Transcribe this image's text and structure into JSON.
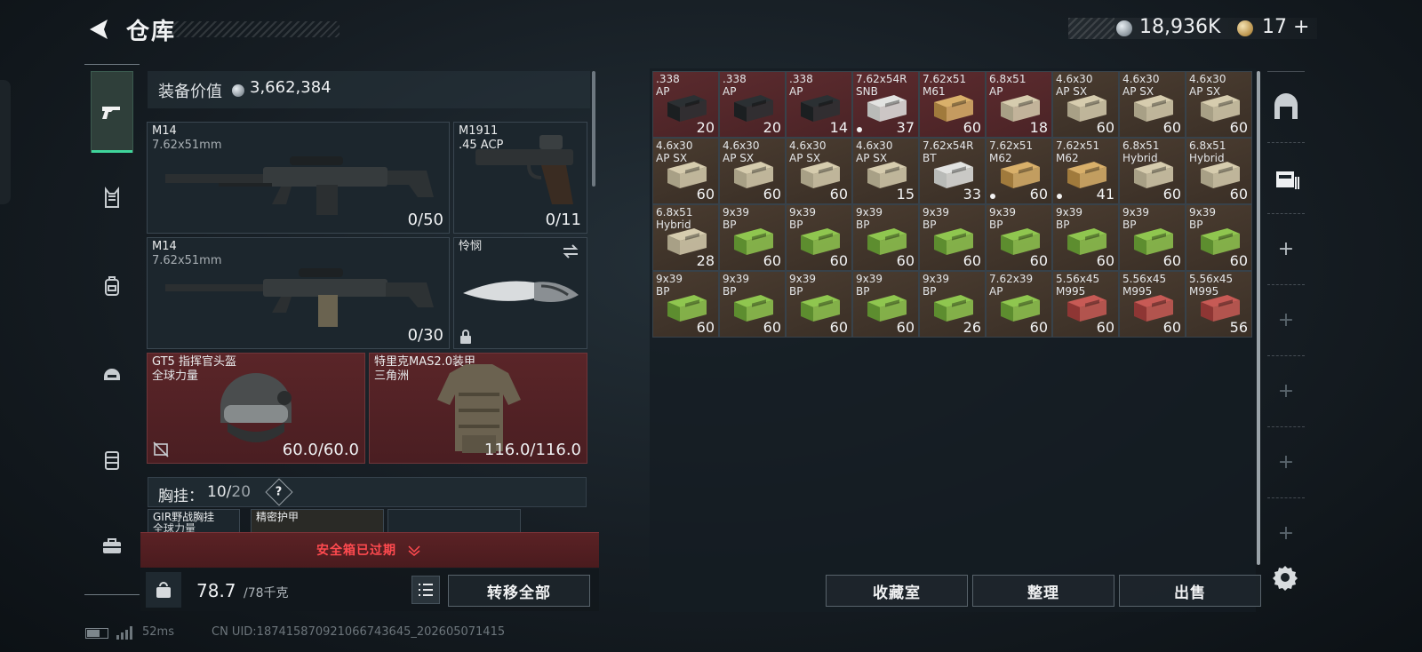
{
  "header": {
    "title": "仓库",
    "coins": "18,936K",
    "tickets": "17",
    "tickets_plus": "+"
  },
  "equipment": {
    "value_label": "装备价值",
    "value": "3,662,384",
    "primary": {
      "name": "M14",
      "caliber": "7.62x51mm",
      "count": "0/50"
    },
    "pistol": {
      "name": "M1911",
      "caliber": ".45 ACP",
      "count": "0/11"
    },
    "secondary": {
      "name": "M14",
      "caliber": "7.62x51mm",
      "count": "0/30"
    },
    "melee": {
      "name": "怜悯"
    },
    "helmet": {
      "name": "GT5 指挥官头盔",
      "faction": "全球力量",
      "durability": "60.0/60.0"
    },
    "armor": {
      "name": "特里克MAS2.0装甲",
      "faction": "三角洲",
      "durability": "116.0/116.0"
    },
    "chest_rig": {
      "label": "胸挂：",
      "used": "10",
      "sep": "/",
      "max": "20",
      "help": "?"
    },
    "mini_slots": {
      "rig": "GIR野战胸挂",
      "rig_sub": "全球力量",
      "vest": "精密护甲"
    },
    "safe_box": "安全箱已过期",
    "weight_current": "78.7",
    "weight_max": "/78千克",
    "transfer_all": "转移全部"
  },
  "inventory": {
    "items": [
      {
        "name": ".338\nAP",
        "count": "20",
        "bg": "red",
        "box": "dark"
      },
      {
        "name": ".338\nAP",
        "count": "20",
        "bg": "red",
        "box": "dark"
      },
      {
        "name": ".338\nAP",
        "count": "14",
        "bg": "red",
        "box": "dark"
      },
      {
        "name": "7.62x54R\nSNB",
        "count": "37",
        "bg": "red",
        "box": "white",
        "dot": true
      },
      {
        "name": "7.62x51\nM61",
        "count": "60",
        "bg": "red",
        "box": "tan"
      },
      {
        "name": "6.8x51\nAP",
        "count": "18",
        "bg": "red",
        "box": "cream"
      },
      {
        "name": "4.6x30\nAP SX",
        "count": "60",
        "bg": "brown",
        "box": "cream"
      },
      {
        "name": "4.6x30\nAP SX",
        "count": "60",
        "bg": "brown",
        "box": "cream"
      },
      {
        "name": "4.6x30\nAP SX",
        "count": "60",
        "bg": "brown",
        "box": "cream"
      },
      {
        "name": "4.6x30\nAP SX",
        "count": "60",
        "bg": "brown",
        "box": "cream"
      },
      {
        "name": "4.6x30\nAP SX",
        "count": "60",
        "bg": "brown",
        "box": "cream"
      },
      {
        "name": "4.6x30\nAP SX",
        "count": "60",
        "bg": "brown",
        "box": "cream"
      },
      {
        "name": "4.6x30\nAP SX",
        "count": "15",
        "bg": "brown",
        "box": "cream"
      },
      {
        "name": "7.62x54R\nBT",
        "count": "33",
        "bg": "brown",
        "box": "white"
      },
      {
        "name": "7.62x51\nM62",
        "count": "60",
        "bg": "brown",
        "box": "tan",
        "dot": true
      },
      {
        "name": "7.62x51\nM62",
        "count": "41",
        "bg": "brown",
        "box": "tan",
        "dot": true
      },
      {
        "name": "6.8x51\nHybrid",
        "count": "60",
        "bg": "brown",
        "box": "cream"
      },
      {
        "name": "6.8x51\nHybrid",
        "count": "60",
        "bg": "brown",
        "box": "cream"
      },
      {
        "name": "6.8x51\nHybrid",
        "count": "28",
        "bg": "brown",
        "box": "cream"
      },
      {
        "name": "9x39\nBP",
        "count": "60",
        "bg": "brown",
        "box": "green"
      },
      {
        "name": "9x39\nBP",
        "count": "60",
        "bg": "brown",
        "box": "green"
      },
      {
        "name": "9x39\nBP",
        "count": "60",
        "bg": "brown",
        "box": "green"
      },
      {
        "name": "9x39\nBP",
        "count": "60",
        "bg": "brown",
        "box": "green"
      },
      {
        "name": "9x39\nBP",
        "count": "60",
        "bg": "brown",
        "box": "green"
      },
      {
        "name": "9x39\nBP",
        "count": "60",
        "bg": "brown",
        "box": "green"
      },
      {
        "name": "9x39\nBP",
        "count": "60",
        "bg": "brown",
        "box": "green"
      },
      {
        "name": "9x39\nBP",
        "count": "60",
        "bg": "brown",
        "box": "green"
      },
      {
        "name": "9x39\nBP",
        "count": "60",
        "bg": "brown",
        "box": "green"
      },
      {
        "name": "9x39\nBP",
        "count": "60",
        "bg": "brown",
        "box": "green"
      },
      {
        "name": "9x39\nBP",
        "count": "60",
        "bg": "brown",
        "box": "green"
      },
      {
        "name": "9x39\nBP",
        "count": "60",
        "bg": "brown",
        "box": "green"
      },
      {
        "name": "9x39\nBP",
        "count": "26",
        "bg": "brown",
        "box": "green"
      },
      {
        "name": "7.62x39\nAP",
        "count": "60",
        "bg": "brown",
        "box": "green"
      },
      {
        "name": "5.56x45\nM995",
        "count": "60",
        "bg": "brown",
        "box": "red"
      },
      {
        "name": "5.56x45\nM995",
        "count": "60",
        "bg": "brown",
        "box": "red"
      },
      {
        "name": "5.56x45\nM995",
        "count": "56",
        "bg": "brown",
        "box": "red"
      }
    ],
    "buttons": {
      "collection": "收藏室",
      "sort": "整理",
      "sell": "出售"
    }
  },
  "footer": {
    "ping": "52ms",
    "uid": "CN UID:187415870921066743645_202605071415"
  },
  "colors": {
    "accent_green": "#3fd59b",
    "warning_red": "#ff4a4f",
    "red_slot": "#5a2528"
  }
}
